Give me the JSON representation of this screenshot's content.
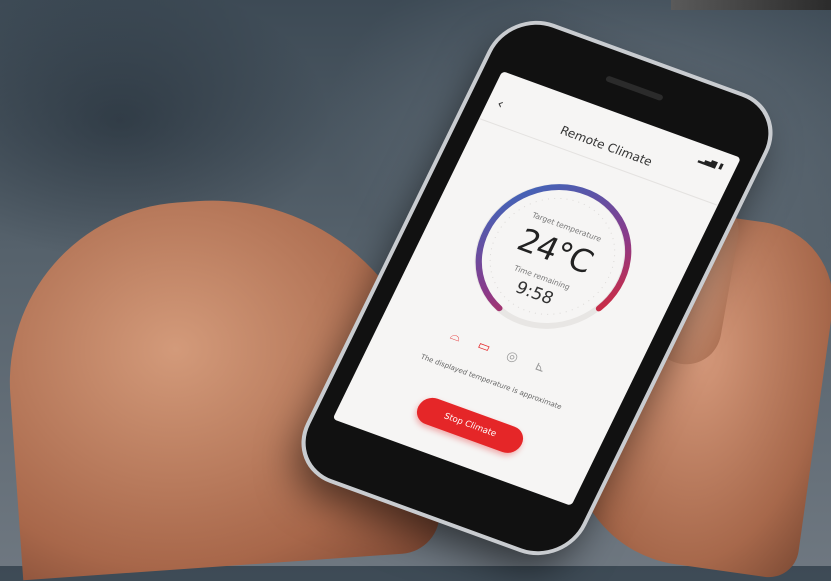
{
  "app": {
    "header": {
      "title": "Remote Climate",
      "back_icon": "chevron-left-icon"
    },
    "status_bar": {
      "signal": "▂▄▆",
      "wifi": "wifi-icon",
      "battery": "battery-icon"
    },
    "dial": {
      "target_label": "Target temperature",
      "temperature": "24°C",
      "time_label": "Time remaining",
      "time_remaining": "9:58",
      "gradient_start": "#2f6fc4",
      "gradient_mid": "#8a3a8a",
      "gradient_end": "#e52628"
    },
    "feature_icons": [
      {
        "name": "front-defrost-icon",
        "glyph": "⌓",
        "state": "active"
      },
      {
        "name": "rear-defrost-icon",
        "glyph": "▭",
        "state": "active"
      },
      {
        "name": "steering-wheel-heat-icon",
        "glyph": "◎",
        "state": "inactive"
      },
      {
        "name": "seat-heat-icon",
        "glyph": "⊾",
        "state": "inactive"
      }
    ],
    "note": "The displayed temperature is approximate",
    "stop_button": {
      "label": "Stop Climate",
      "color": "#e52628"
    }
  }
}
